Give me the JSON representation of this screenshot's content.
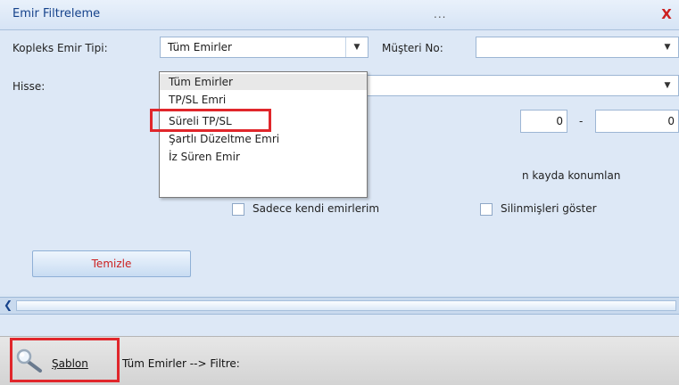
{
  "window": {
    "title": "Emir Filtreleme",
    "dots": "...",
    "close_label": "X"
  },
  "form": {
    "emir_tipi_label": "Kopleks Emir Tipi:",
    "emir_tipi_value": "Tüm Emirler",
    "musteri_label": "Müşteri No:",
    "musteri_value": "",
    "hisse_label": "Hisse:",
    "num_from": "0",
    "range_dash": "-",
    "num_to": "0",
    "checkbox_kayda": "n kayda konumlan",
    "checkbox_sadece": "Sadece kendi emirlerim",
    "checkbox_silinmis": "Silinmişleri göster",
    "clear_button": "Temizle"
  },
  "dropdown": {
    "options": [
      "Tüm Emirler",
      "TP/SL Emri",
      "Süreli TP/SL",
      "Şartlı Düzeltme Emri",
      "İz Süren Emir"
    ],
    "highlighted_index": 2
  },
  "bottombar": {
    "sablon_label": "Şablon",
    "filter_text": "Tüm Emirler --> Filtre:"
  },
  "colors": {
    "accent_red": "#e0262b",
    "title_blue": "#15428b"
  }
}
